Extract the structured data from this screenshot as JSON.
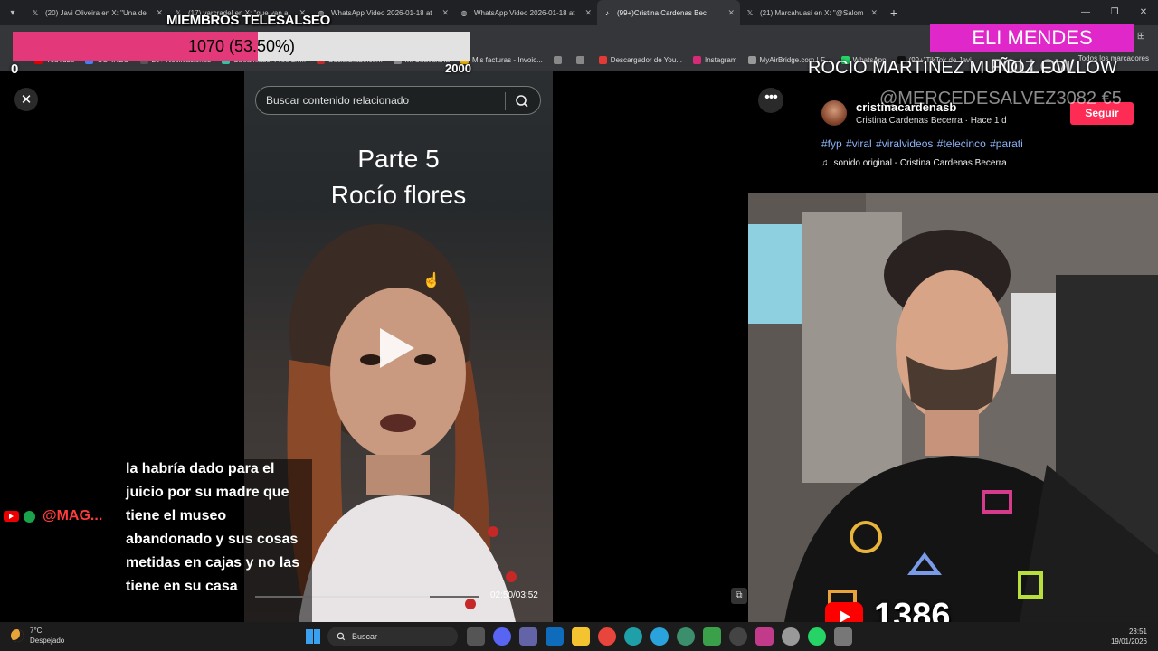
{
  "browser": {
    "tabs": [
      {
        "title": "(20) Javi Oliveira en X: \"Una de",
        "favicon": "x-icon"
      },
      {
        "title": "(17) varcradel en X: \"que van a",
        "favicon": "x-icon"
      },
      {
        "title": "WhatsApp Video 2026-01-18 at",
        "favicon": "globe-icon"
      },
      {
        "title": "WhatsApp Video 2026-01-18 at",
        "favicon": "globe-icon"
      },
      {
        "title": "(99+)Cristina Cardenas Bec",
        "favicon": "tiktok-icon",
        "active": true
      },
      {
        "title": "(21) Marcahuasi en X: \"@Salom",
        "favicon": "x-icon"
      }
    ],
    "bookmarks": [
      {
        "label": "YouTube",
        "color": "#e00000"
      },
      {
        "label": "CORREO",
        "color": "#3b82f6"
      },
      {
        "label": "20+ Notificaciones",
        "color": "#555555"
      },
      {
        "label": "Streamlabs: Free Liv...",
        "color": "#31c3a2"
      },
      {
        "label": "SocialBlade.com",
        "color": "#c62828"
      },
      {
        "label": "Mi Chavalería",
        "color": "#888888"
      },
      {
        "label": "Mis facturas - Invoic...",
        "color": "#f5b700"
      },
      {
        "label": "",
        "color": "#888888"
      },
      {
        "label": "",
        "color": "#888888"
      },
      {
        "label": "Descargador de You...",
        "color": "#e53935"
      },
      {
        "label": "Instagram",
        "color": "#d62976"
      },
      {
        "label": "MyAirBridge.com | F...",
        "color": "#999999"
      },
      {
        "label": "WhatsApp",
        "color": "#25d366"
      },
      {
        "label": "(99+)TikTok de Javi",
        "color": "#111111"
      }
    ],
    "bookmarks_all": "Todos los marcadores"
  },
  "overlay": {
    "goal_title": "MIEMBROS TELESALSEO",
    "goal_text": "1070 (53.50%)",
    "goal_min": "0",
    "goal_max": "2000",
    "goal_progress": 0.535,
    "goal_color": "#e3397a",
    "alert_1": "ELI MENDES  FOLLOW",
    "alert_2": "ROCIO MARTINEZ MUÑOZ  FOLLOW",
    "alert_3": "@MERCEDESALVEZ3082  €5",
    "alert_color": "#e028ca"
  },
  "tiktok": {
    "search_placeholder": "Buscar contenido relacionado",
    "video_title_line1": "Parte 5",
    "video_title_line2": "Rocío flores",
    "time": "02:50/03:52",
    "progress": 0.78,
    "author_handle": "cristinacardenasb",
    "author_meta": "Cristina Cardenas Becerra · Hace 1 d",
    "follow_label": "Seguir",
    "hashtags": "#fyp #viral #viralvideos #telecinco #parati",
    "sound": "sonido original - Cristina Cardenas Becerra",
    "follow_color": "#fe2c55"
  },
  "chat": {
    "username": "@MAG...",
    "message": "la habría dado para el juicio por su madre que tiene el museo abandonado y sus cosas metidas en cajas y no las tiene en su casa"
  },
  "viewers": {
    "count": "1386"
  },
  "taskbar": {
    "weather_temp": "7°C",
    "weather_desc": "Despejado",
    "search_label": "Buscar",
    "time": "23:51",
    "date": "19/01/2026"
  }
}
